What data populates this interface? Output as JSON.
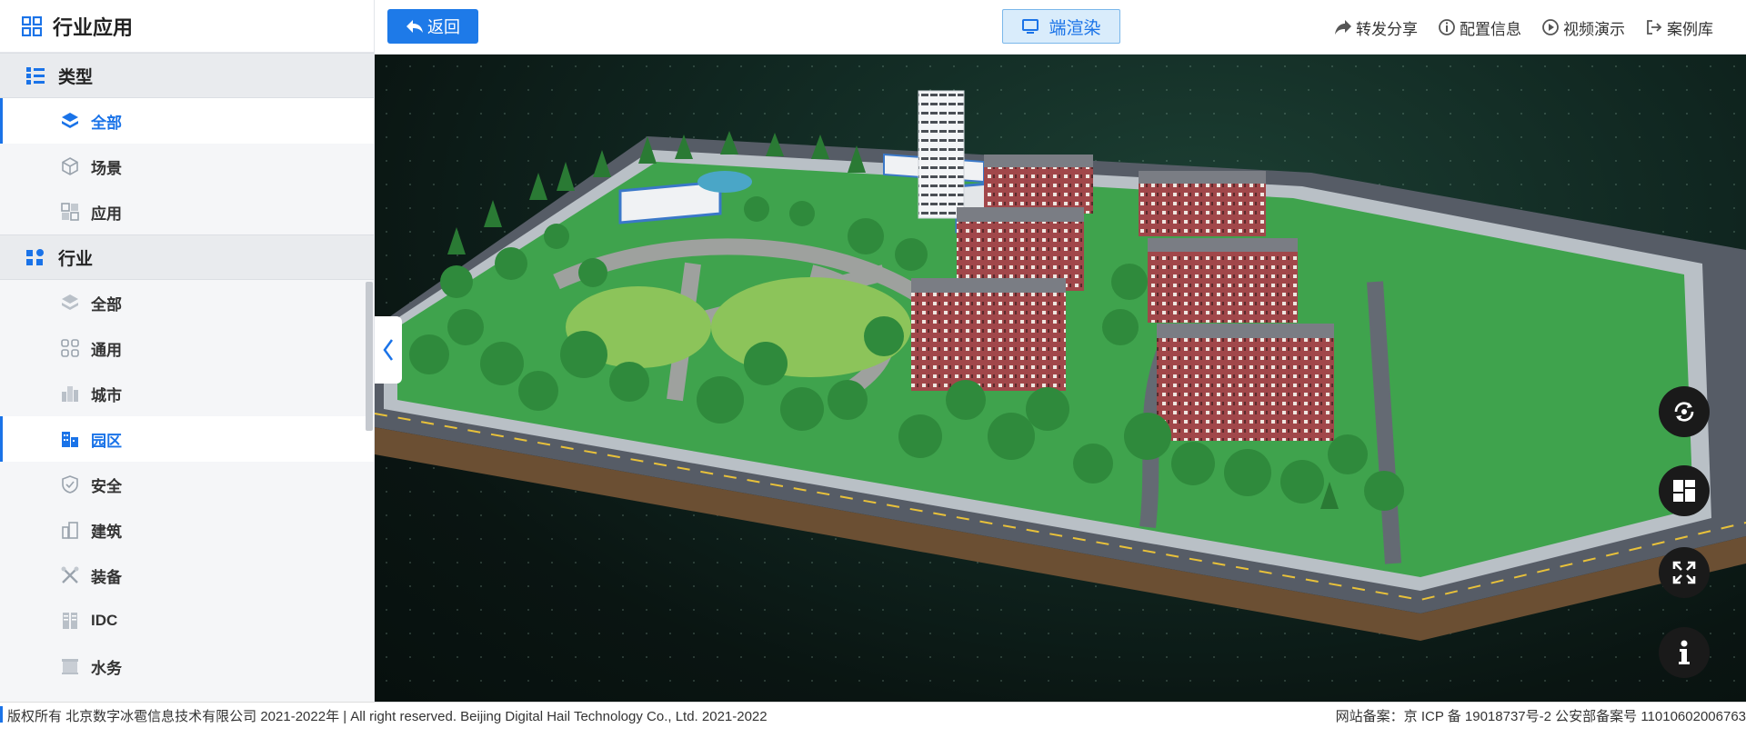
{
  "sidebar": {
    "title": "行业应用",
    "sections": [
      {
        "label": "类型",
        "items": [
          {
            "label": "全部",
            "active": true
          },
          {
            "label": "场景",
            "active": false
          },
          {
            "label": "应用",
            "active": false
          }
        ]
      },
      {
        "label": "行业",
        "items": [
          {
            "label": "全部",
            "active": false
          },
          {
            "label": "通用",
            "active": false
          },
          {
            "label": "城市",
            "active": false
          },
          {
            "label": "园区",
            "active": true
          },
          {
            "label": "安全",
            "active": false
          },
          {
            "label": "建筑",
            "active": false
          },
          {
            "label": "装备",
            "active": false
          },
          {
            "label": "IDC",
            "active": false
          },
          {
            "label": "水务",
            "active": false
          }
        ]
      }
    ]
  },
  "toolbar": {
    "back_label": "返回",
    "render_label": "端渲染",
    "actions": [
      "转发分享",
      "配置信息",
      "视频演示",
      "案例库"
    ]
  },
  "footer": {
    "copyright": "版权所有 北京数字冰雹信息技术有限公司 2021-2022年 | All right reserved. Beijing Digital Hail Technology Co., Ltd. 2021-2022",
    "icp": "网站备案：京 ICP 备 19018737号-2 公安部备案号 11010602006763"
  },
  "colors": {
    "accent": "#1a73e8",
    "grass": "#3fa34d",
    "brick": "#a1474a"
  }
}
